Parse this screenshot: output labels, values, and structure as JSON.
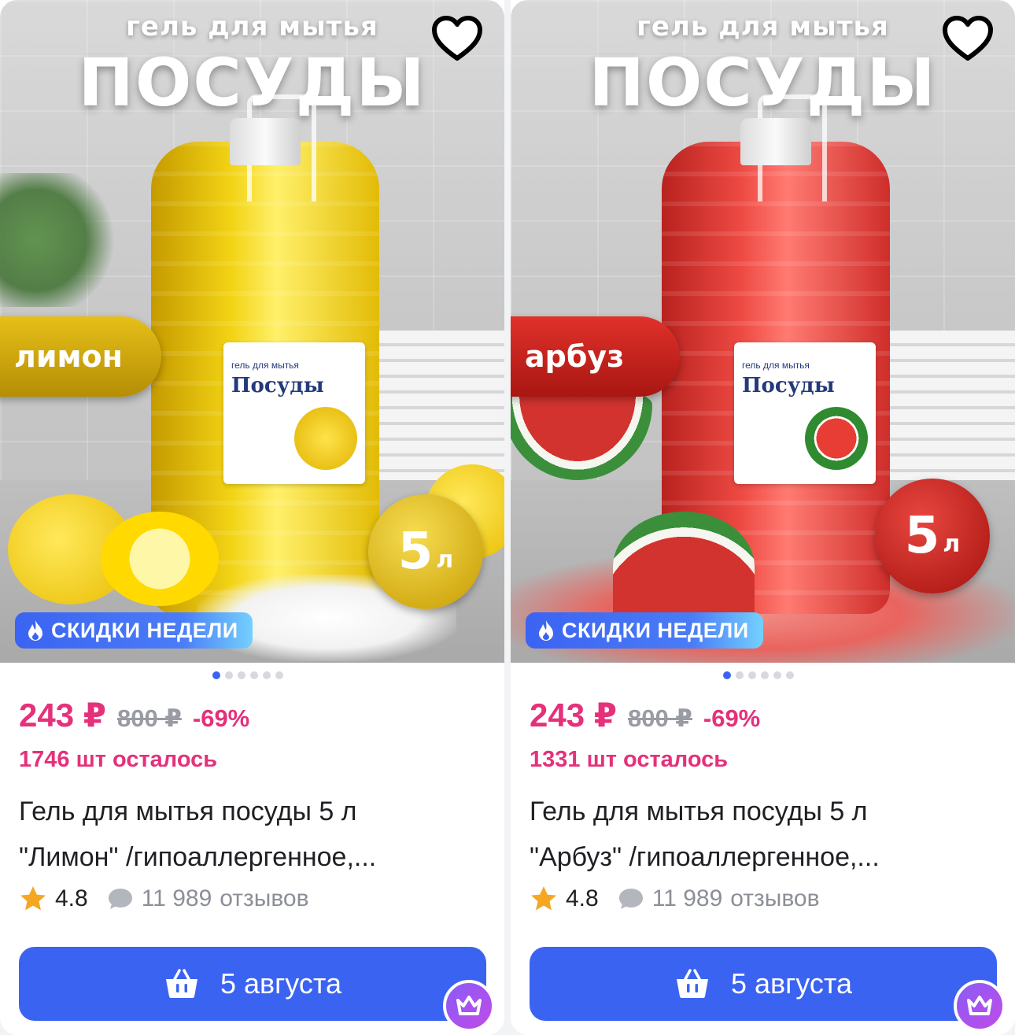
{
  "colors": {
    "accent": "#3b63f2",
    "price": "#e4317a",
    "muted": "#9a9ca4"
  },
  "products": [
    {
      "image": {
        "headline_small": "гель для мытья",
        "headline_big": "ПОСУДЫ",
        "flavor_label": "лимон",
        "volume_number": "5",
        "volume_unit": "л",
        "bottle_label_small": "гель для мытья",
        "bottle_label_title": "Посуды"
      },
      "favorite_icon": "heart-outline-icon",
      "sale_badge": "СКИДКИ НЕДЕЛИ",
      "carousel_dots": 6,
      "carousel_active": 0,
      "price": "243 ₽",
      "old_price": "800 ₽",
      "discount": "-69%",
      "stock": "1746 шт осталось",
      "title_line1": "Гель для мытья посуды 5 л",
      "title_line2": "\"Лимон\" /гипоаллергенное,...",
      "rating": "4.8",
      "reviews_count": "11 989",
      "reviews_label": "отзывов",
      "cart_label": "5 августа"
    },
    {
      "image": {
        "headline_small": "гель для мытья",
        "headline_big": "ПОСУДЫ",
        "flavor_label": "арбуз",
        "volume_number": "5",
        "volume_unit": "л",
        "bottle_label_small": "гель для мытья",
        "bottle_label_title": "Посуды"
      },
      "favorite_icon": "heart-outline-icon",
      "sale_badge": "СКИДКИ НЕДЕЛИ",
      "carousel_dots": 6,
      "carousel_active": 0,
      "price": "243 ₽",
      "old_price": "800 ₽",
      "discount": "-69%",
      "stock": "1331 шт осталось",
      "title_line1": "Гель для мытья посуды 5 л",
      "title_line2": "\"Арбуз\" /гипоаллергенное,...",
      "rating": "4.8",
      "reviews_count": "11 989",
      "reviews_label": "отзывов",
      "cart_label": "5 августа"
    }
  ]
}
